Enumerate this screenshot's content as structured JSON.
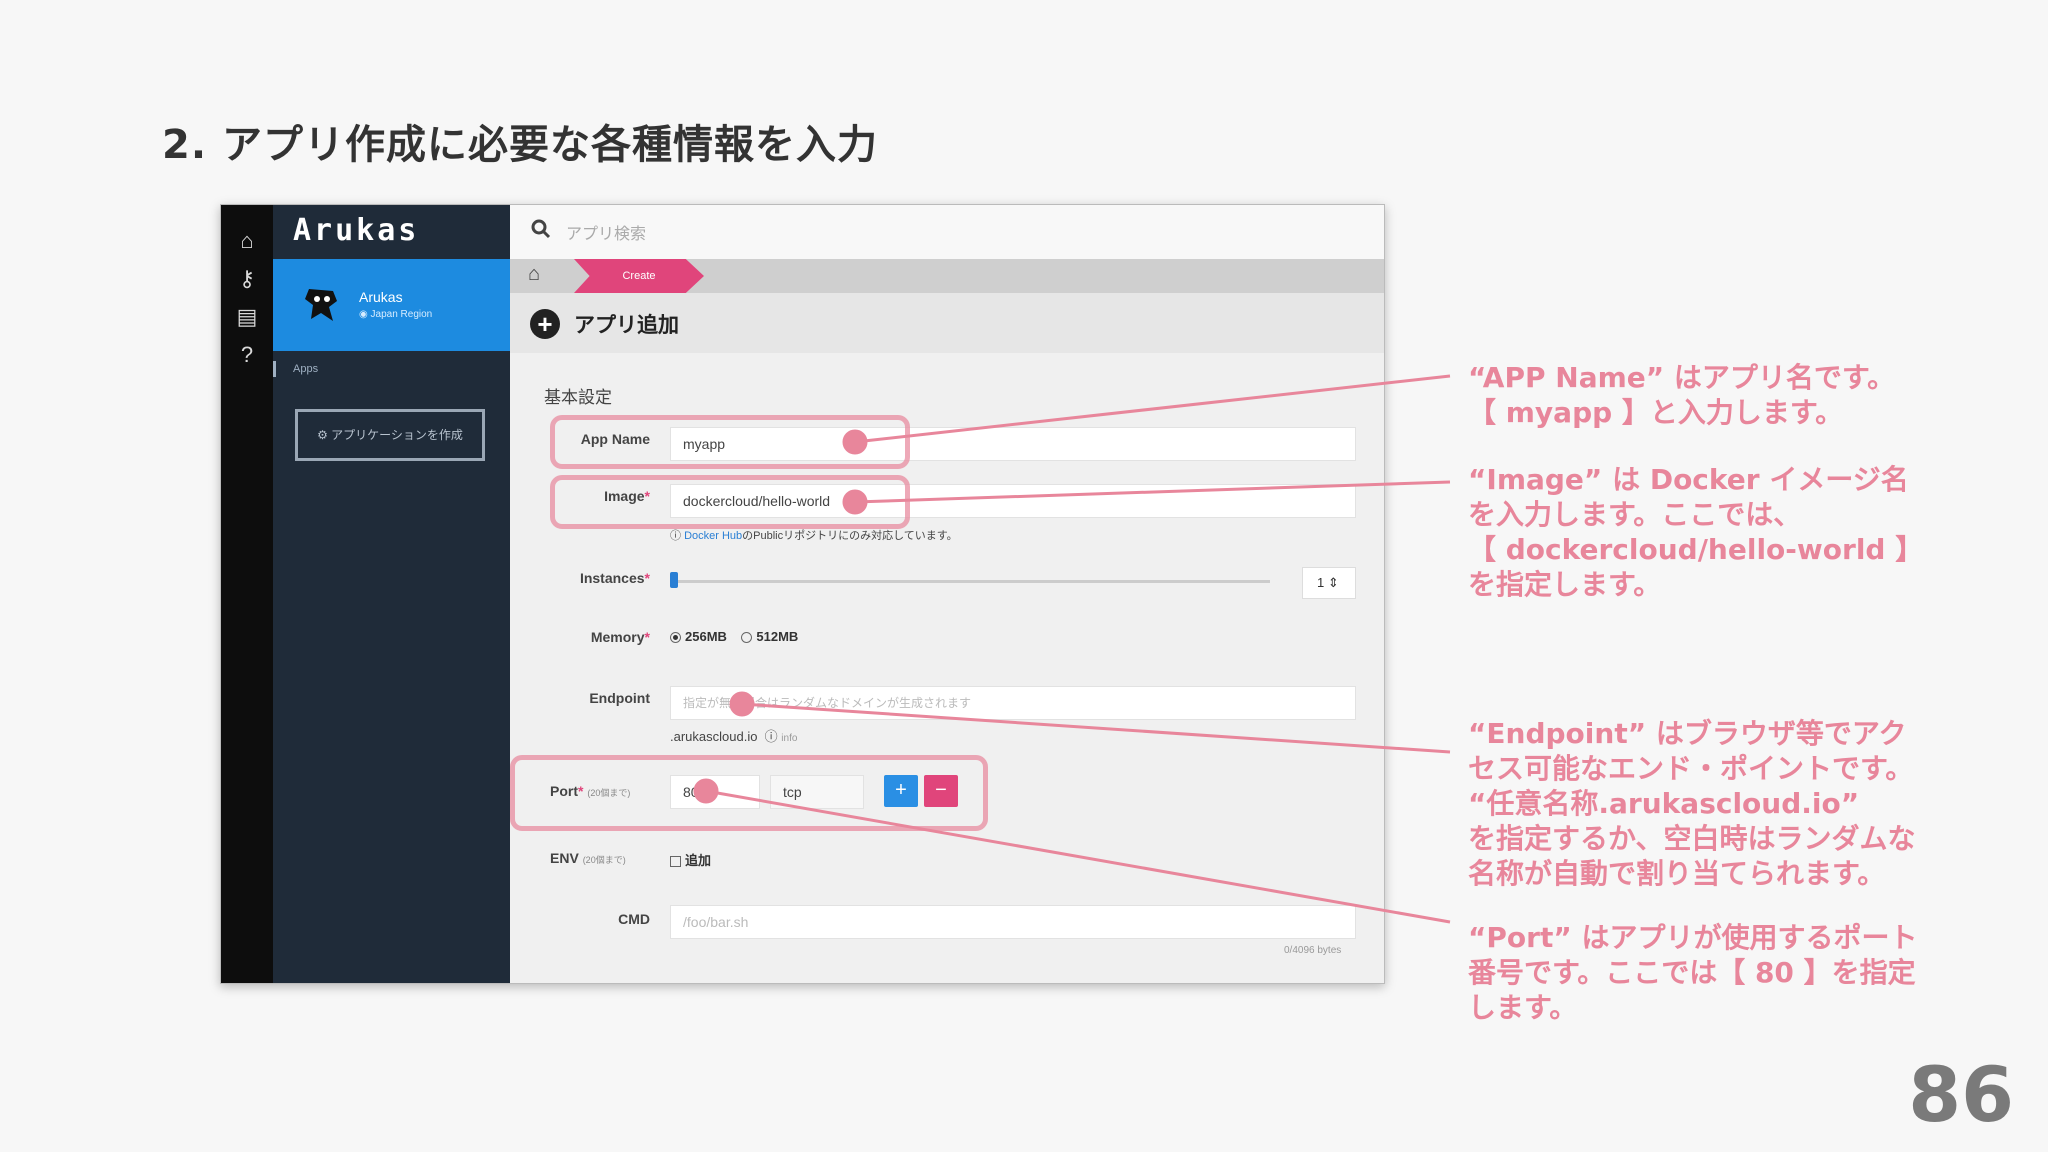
{
  "slide": {
    "title": "2. アプリ作成に必要な各種情報を入力",
    "page_number": "86"
  },
  "app": {
    "logo": "Arukas",
    "account_name": "Arukas",
    "account_region": "Japan Region",
    "nav_apps": "Apps",
    "create_app_button": "アプリケーションを作成",
    "search_placeholder": "アプリ検索",
    "breadcrumb_current": "Create",
    "page_heading": "アプリ追加",
    "section_title": "基本設定"
  },
  "form": {
    "app_name": {
      "label": "App Name",
      "value": "myapp"
    },
    "image": {
      "label": "Image",
      "required": "*",
      "value": "dockercloud/hello-world",
      "help_link": "Docker Hub",
      "help_text": "のPublicリポジトリにのみ対応しています。"
    },
    "instances": {
      "label": "Instances",
      "required": "*",
      "value": "1"
    },
    "memory": {
      "label": "Memory",
      "required": "*",
      "options": [
        "256MB",
        "512MB"
      ],
      "selected": "256MB"
    },
    "endpoint": {
      "label": "Endpoint",
      "placeholder": "指定が無い場合はランダムなドメインが生成されます",
      "suffix": ".arukascloud.io",
      "info": "info"
    },
    "port": {
      "label": "Port",
      "required": "*",
      "sub": "(20個まで)",
      "value": "80",
      "protocol": "tcp",
      "add": "+",
      "remove": "−"
    },
    "env": {
      "label": "ENV",
      "sub": "(20個まで)",
      "checkbox_label": "追加"
    },
    "cmd": {
      "label": "CMD",
      "placeholder": "/foo/bar.sh",
      "counter": "0/4096 bytes"
    }
  },
  "annotations": {
    "app_name": "“APP Name” はアプリ名です。\n【 myapp 】と入力します。",
    "image": "“Image” は Docker イメージ名\nを入力します。ここでは、\n【 dockercloud/hello-world 】\nを指定します。",
    "endpoint": "“Endpoint” はブラウザ等でアク\nセス可能なエンド・ポイントです。\n“任意名称.arukascloud.io”\nを指定するか、空白時はランダムな\n名称が自動で割り当てられます。",
    "port": "“Port” はアプリが使用するポート\n番号です。ここでは【 80 】を指定\nします。"
  },
  "colors": {
    "accent_pink": "#e0457b",
    "annotation": "#e8869b",
    "account_blue": "#1d8be0",
    "sidebar": "#1f2b39"
  }
}
